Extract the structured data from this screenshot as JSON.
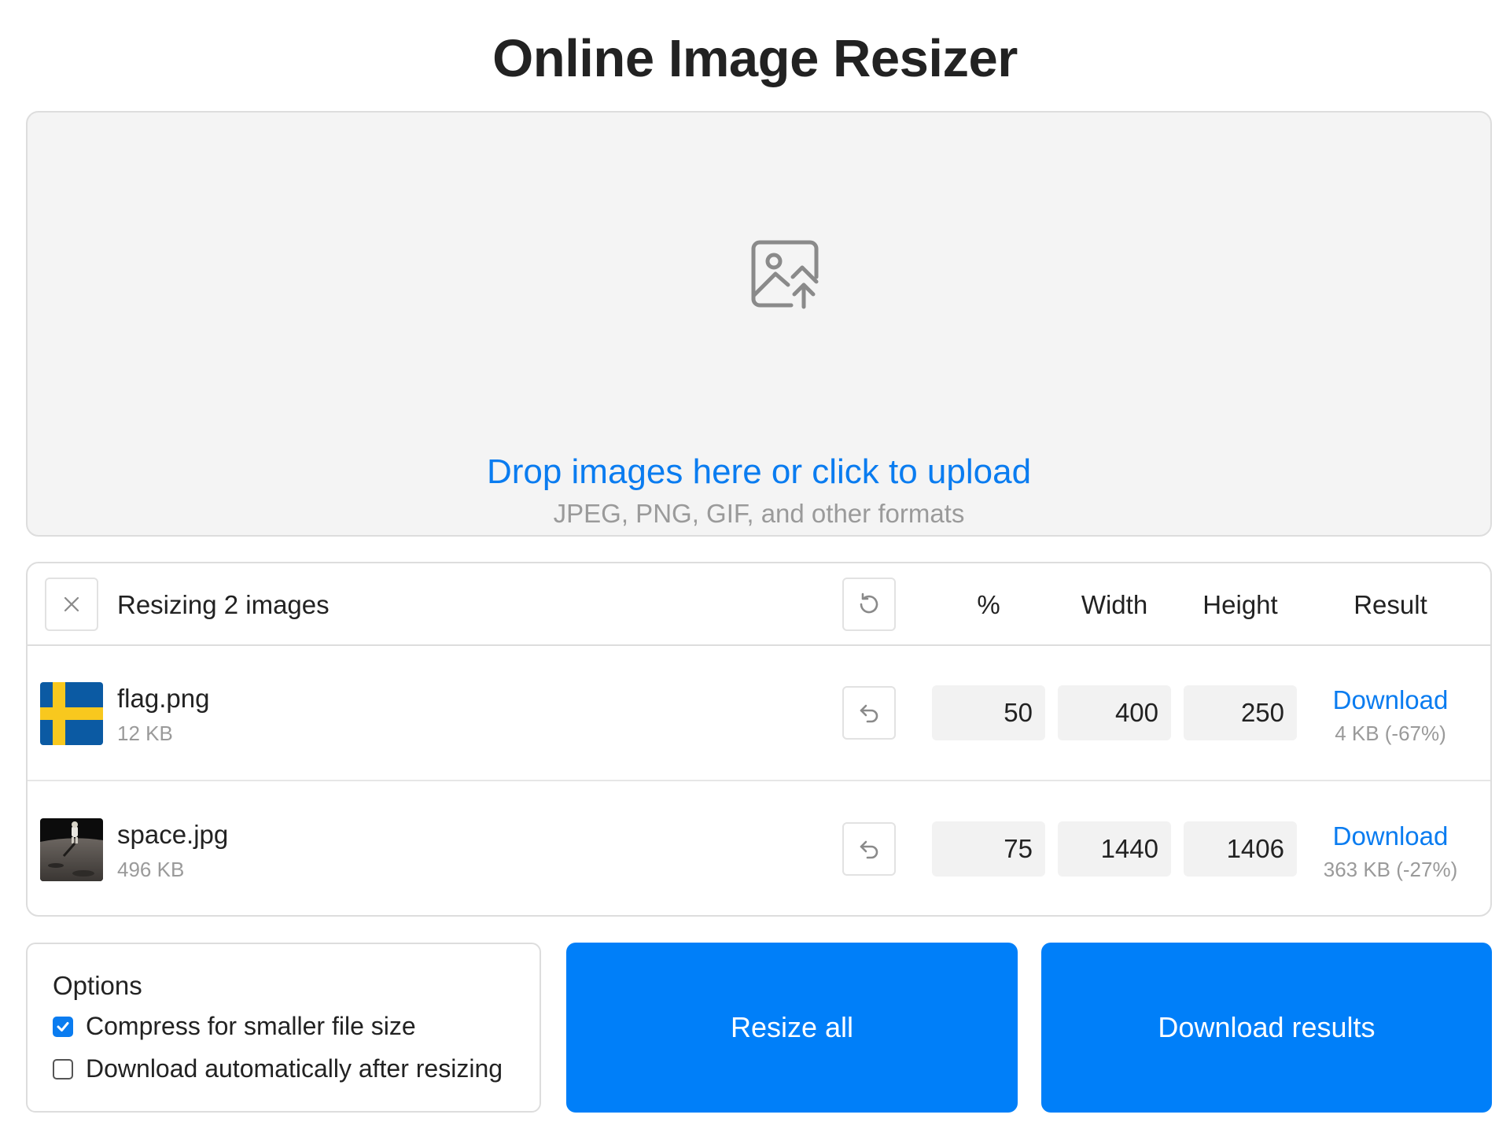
{
  "page": {
    "title": "Online Image Resizer"
  },
  "dropzone": {
    "title": "Drop images here or click to upload",
    "subtitle": "JPEG, PNG, GIF, and other formats",
    "icon": "image-upload-icon"
  },
  "files_panel": {
    "header": {
      "label": "Resizing 2 images",
      "columns": {
        "percent": "%",
        "width": "Width",
        "height": "Height",
        "result": "Result"
      }
    },
    "rows": [
      {
        "name": "flag.png",
        "size": "12 KB",
        "percent": "50",
        "width": "400",
        "height": "250",
        "download_label": "Download",
        "result_info": "4 KB (-67%)",
        "thumbnail": "swedish-flag"
      },
      {
        "name": "space.jpg",
        "size": "496 KB",
        "percent": "75",
        "width": "1440",
        "height": "1406",
        "download_label": "Download",
        "result_info": "363 KB (-27%)",
        "thumbnail": "astronaut-moon-photo"
      }
    ]
  },
  "options": {
    "title": "Options",
    "compress": {
      "label": "Compress for smaller file size",
      "checked": true
    },
    "auto_download": {
      "label": "Download automatically after resizing",
      "checked": false
    }
  },
  "actions": {
    "resize_all": "Resize all",
    "download_results": "Download results"
  },
  "colors": {
    "accent": "#007ff9",
    "link": "#0a7cf0",
    "muted": "#9a9a9a"
  }
}
